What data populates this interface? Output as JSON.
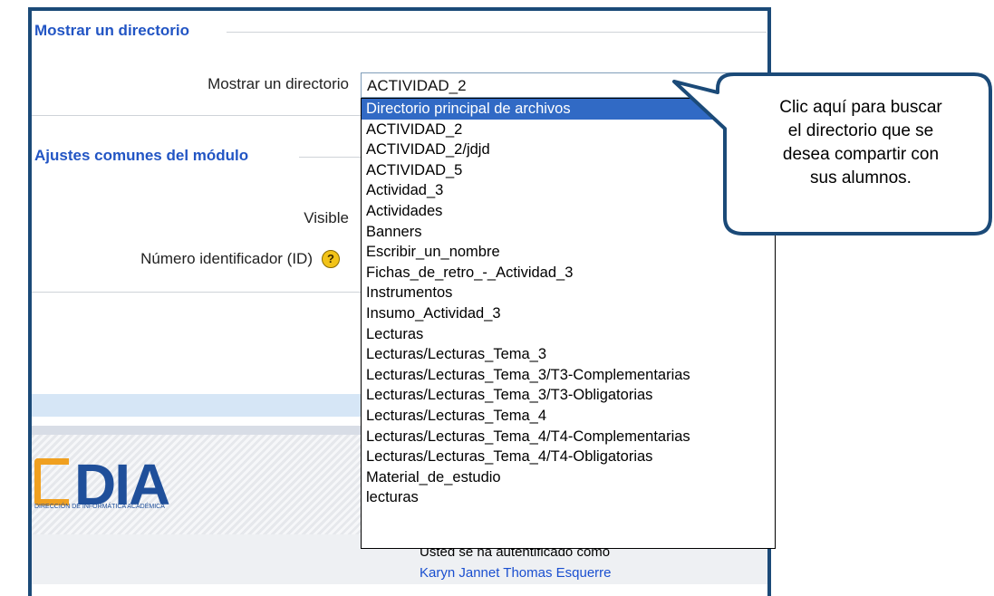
{
  "section1": {
    "title": "Mostrar un directorio"
  },
  "field_directory": {
    "label": "Mostrar un directorio",
    "selected": "ACTIVIDAD_2"
  },
  "section2": {
    "title": "Ajustes comunes del módulo"
  },
  "field_visible": {
    "label": "Visible"
  },
  "field_id": {
    "label": "Número identificador (ID)"
  },
  "dropdown": {
    "options": [
      "Directorio principal de archivos",
      "ACTIVIDAD_2",
      "ACTIVIDAD_2/jdjd",
      "ACTIVIDAD_5",
      "Actividad_3",
      "Actividades",
      "Banners",
      "Escribir_un_nombre",
      "Fichas_de_retro_-_Actividad_3",
      "Instrumentos",
      "Insumo_Actividad_3",
      "Lecturas",
      "Lecturas/Lecturas_Tema_3",
      "Lecturas/Lecturas_Tema_3/T3-Complementarias",
      "Lecturas/Lecturas_Tema_3/T3-Obligatorias",
      "Lecturas/Lecturas_Tema_4",
      "Lecturas/Lecturas_Tema_4/T4-Complementarias",
      "Lecturas/Lecturas_Tema_4/T4-Obligatorias",
      "Material_de_estudio",
      "lecturas"
    ],
    "highlighted": "Directorio principal de archivos"
  },
  "callout": {
    "lines": [
      "Clic aquí para buscar",
      "el directorio que  se",
      "desea compartir con",
      "sus alumnos."
    ]
  },
  "footer": {
    "logo": "DIA",
    "logo_sub": "DIRECCIÓN DE INFORMÁTICA ACADÉMICA",
    "auth_text": "Usted se ha autentificado como",
    "user_name": "Karyn Jannet Thomas Esquerre"
  },
  "colors": {
    "border": "#1b4a78",
    "section_title": "#2255c4",
    "highlight": "#316ac5"
  },
  "icons": {
    "help": "help-icon"
  }
}
